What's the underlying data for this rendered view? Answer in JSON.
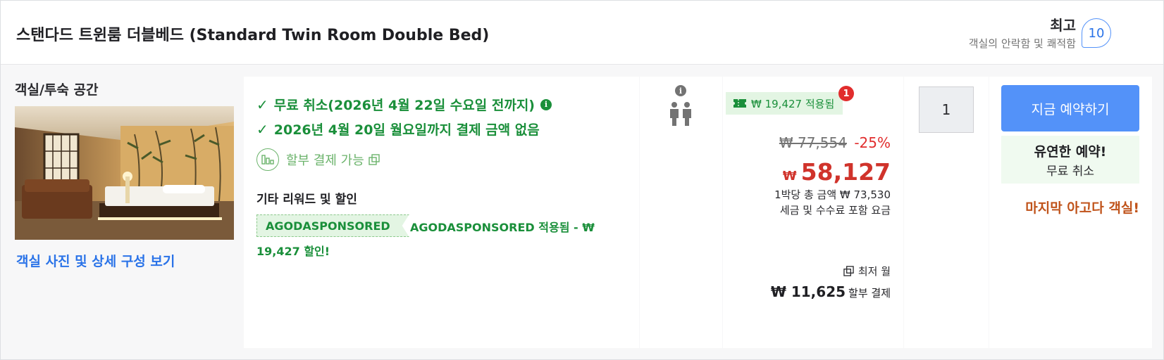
{
  "header": {
    "room_title": "스탠다드 트윈룸 더블베드 (Standard Twin Room Double Bed)",
    "score_label": "최고",
    "score_sub": "객실의 안락함 및 쾌적함",
    "score_value": "10"
  },
  "left": {
    "room_space_label": "객실/투숙 공간",
    "details_link": "객실 사진 및 상세 구성 보기"
  },
  "benefits": {
    "free_cancel": "무료 취소(2026년 4월 22일 수요일 전까지)",
    "pay_later": "2026년 4월 20일 월요일까지 결제 금액 없음",
    "installment": "할부 결제 가능",
    "rewards_title": "기타 리워드 및 할인",
    "promo_code": "AGODASPONSORED",
    "promo_text": "AGODASPONSORED 적용됨 - ₩ 19,427 할인!"
  },
  "price": {
    "coupon": "₩ 19,427 적용됨",
    "coupon_count": "1",
    "original": "₩ 77,554",
    "discount": "-25%",
    "currency": "₩",
    "final": "58,127",
    "total_note": "1박당 총 금액 ₩ 73,530",
    "tax_note": "세금 및 수수료 포함 요금",
    "monthly_label": "최저 월",
    "monthly_amount": "₩ 11,625",
    "monthly_suffix": "할부 결제"
  },
  "quantity": {
    "value": "1"
  },
  "booking": {
    "book_button": "지금 예약하기",
    "flex_title": "유연한 예약!",
    "flex_sub": "무료 취소",
    "last_room": "마지막 아고다 객실!"
  }
}
